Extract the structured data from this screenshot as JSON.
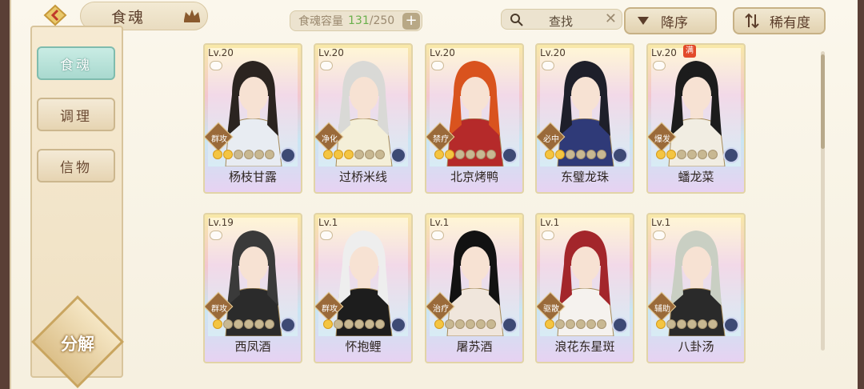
{
  "header": {
    "title": "食魂",
    "capacity_label": "食魂容量",
    "capacity_current": "131",
    "capacity_max": "/250",
    "plus_label": "+",
    "search_label": "查找",
    "search_clear": "✕",
    "sort_order_label": "降序",
    "sort_by_label": "稀有度"
  },
  "sidebar": {
    "items": [
      {
        "label": "食魂",
        "active": true
      },
      {
        "label": "调理",
        "active": false
      },
      {
        "label": "信物",
        "active": false
      }
    ],
    "decompose_label": "分解"
  },
  "cards": [
    {
      "level": "Lv.20",
      "role": "群攻",
      "name": "杨枝甘露",
      "stars_on": 2,
      "hair": "#2b2420",
      "outfit": "#e8ecf2"
    },
    {
      "level": "Lv.20",
      "role": "净化",
      "name": "过桥米线",
      "stars_on": 3,
      "hair": "#d9d9d6",
      "outfit": "#f4efd8"
    },
    {
      "level": "Lv.20",
      "role": "禁疗",
      "name": "北京烤鸭",
      "stars_on": 2,
      "hair": "#d9531e",
      "outfit": "#b52a2a"
    },
    {
      "level": "Lv.20",
      "role": "必中",
      "name": "东璧龙珠",
      "stars_on": 2,
      "hair": "#1e1f2a",
      "outfit": "#2f3a78"
    },
    {
      "level": "Lv.20",
      "role": "爆发",
      "name": "蟠龙菜",
      "stars_on": 2,
      "hair": "#1c1c1c",
      "outfit": "#f1ede2",
      "max_badge": "满"
    },
    {
      "level": "Lv.19",
      "role": "群攻",
      "name": "西凤酒",
      "stars_on": 1,
      "hair": "#3a3a3a",
      "outfit": "#2b2b2b"
    },
    {
      "level": "Lv.1",
      "role": "群攻",
      "name": "怀抱鲤",
      "stars_on": 1,
      "hair": "#eeeeee",
      "outfit": "#1d1d1d"
    },
    {
      "level": "Lv.1",
      "role": "治疗",
      "name": "屠苏酒",
      "stars_on": 1,
      "hair": "#121212",
      "outfit": "#f0e6dc"
    },
    {
      "level": "Lv.1",
      "role": "驱散",
      "name": "浪花东星斑",
      "stars_on": 1,
      "hair": "#a3262b",
      "outfit": "#f5f2ee"
    },
    {
      "level": "Lv.1",
      "role": "辅助",
      "name": "八卦汤",
      "stars_on": 1,
      "hair": "#c9cfc3",
      "outfit": "#2a2a2a"
    }
  ],
  "colors": {
    "accent_teal": "#a9d9cf",
    "capacity_green": "#6ab04c",
    "card_border": "#e2d4a6"
  }
}
